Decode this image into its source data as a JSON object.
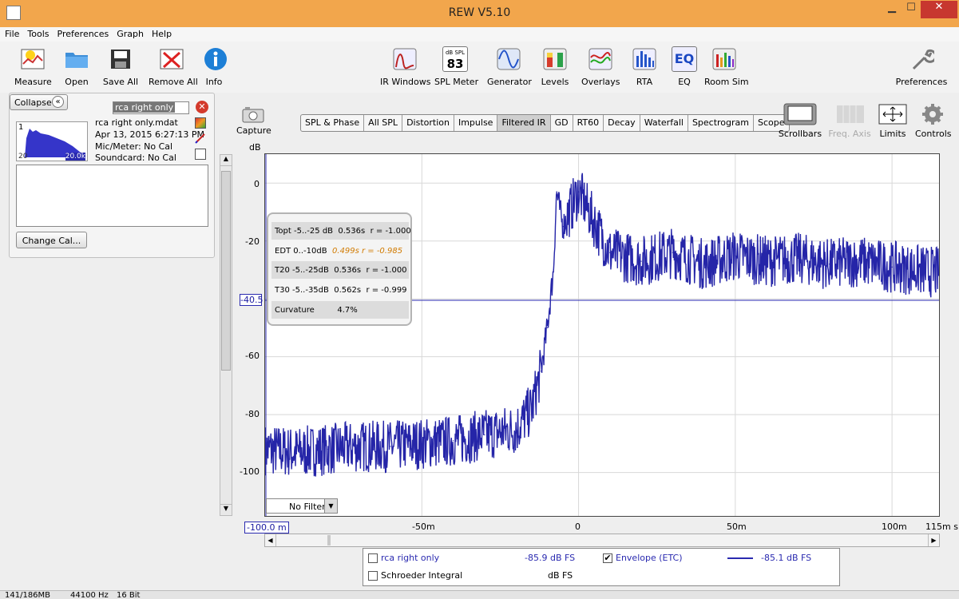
{
  "window": {
    "title": "REW V5.10",
    "minimize": "▁",
    "maximize": "☐",
    "close": "✕"
  },
  "menu": [
    "File",
    "Tools",
    "Preferences",
    "Graph",
    "Help"
  ],
  "toolbar": {
    "measure": "Measure",
    "open": "Open",
    "save_all": "Save All",
    "remove_all": "Remove All",
    "info": "Info",
    "ir_windows": "IR Windows",
    "spl_meter": "SPL Meter",
    "spl_badge_top": "dB SPL",
    "spl_badge_val": "83",
    "generator": "Generator",
    "levels": "Levels",
    "overlays": "Overlays",
    "rta": "RTA",
    "eq": "EQ",
    "eq_badge": "EQ",
    "room_sim": "Room Sim",
    "preferences": "Preferences"
  },
  "measurements_panel": {
    "collapse": "Collapse",
    "collapse_icon": "«",
    "name_field": "rca right only",
    "index": "1",
    "file": "rca right only.mdat",
    "date": "Apr 13, 2015 6:27:13 PM",
    "mic": "Mic/Meter: No Cal",
    "soundcard": "Soundcard: No Cal",
    "thumb_left": "20",
    "thumb_right": "20.0k",
    "change_cal": "Change Cal..."
  },
  "graph_controls": {
    "capture": "Capture",
    "scrollbars": "Scrollbars",
    "freq_axis": "Freq. Axis",
    "limits": "Limits",
    "controls": "Controls"
  },
  "tabs": [
    {
      "label": "SPL & Phase",
      "active": false
    },
    {
      "label": "All SPL",
      "active": false
    },
    {
      "label": "Distortion",
      "active": false
    },
    {
      "label": "Impulse",
      "active": false
    },
    {
      "label": "Filtered IR",
      "active": true
    },
    {
      "label": "GD",
      "active": false
    },
    {
      "label": "RT60",
      "active": false
    },
    {
      "label": "Decay",
      "active": false
    },
    {
      "label": "Waterfall",
      "active": false
    },
    {
      "label": "Spectrogram",
      "active": false
    },
    {
      "label": "Scope",
      "active": false
    }
  ],
  "axis": {
    "y_unit": "dB",
    "y_ticks": [
      "0",
      "-20",
      "-40.5",
      "-60",
      "-80",
      "-100"
    ],
    "x_ticks": [
      "-100.0 m",
      "-50m",
      "0",
      "50m",
      "100m",
      "115m s"
    ]
  },
  "rt_table": {
    "rows": [
      {
        "label": "Topt -5..-25 dB",
        "time": "0.536s",
        "r": "r = -1.000",
        "highlight": false
      },
      {
        "label": "EDT  0..-10dB",
        "time": "0.499s",
        "r": "r = -0.985",
        "highlight": true
      },
      {
        "label": "T20 -5..-25dB",
        "time": "0.536s",
        "r": "r = -1.000",
        "highlight": false
      },
      {
        "label": "T30 -5..-35dB",
        "time": "0.562s",
        "r": "r = -0.999",
        "highlight": false
      },
      {
        "label": "Curvature",
        "time": "4.7%",
        "r": "",
        "highlight": false
      }
    ]
  },
  "filter": {
    "value": "No Filter"
  },
  "legend": {
    "row1_name": "rca right only",
    "row1_value": "-85.9 dB FS",
    "envelope_name": "Envelope (ETC)",
    "envelope_value": "-85.1 dB FS",
    "envelope_checked": "✔",
    "row2_name": "Schroeder Integral",
    "row2_value": "dB FS"
  },
  "statusbar": {
    "memory": "141/186MB",
    "rate": "44100 Hz",
    "bits": "16 Bit"
  },
  "chart_data": {
    "type": "line",
    "xlabel": "",
    "ylabel": "dB",
    "xlim": [
      -100,
      115
    ],
    "ylim": [
      -115,
      10
    ],
    "cursor_y": -40.5,
    "series": [
      {
        "color": "#2525a8",
        "x": [
          -100,
          -90,
          -80,
          -70,
          -60,
          -50,
          -40,
          -30,
          -20,
          -15,
          -12,
          -10,
          -8,
          -7,
          -5,
          -3,
          0,
          10,
          20,
          30,
          40,
          50,
          60,
          70,
          80,
          90,
          100,
          115
        ],
        "y": [
          -92,
          -93,
          -92,
          -91,
          -91,
          -90,
          -89,
          -87,
          -85,
          -78,
          -65,
          -50,
          -30,
          -3,
          -15,
          -10,
          -3,
          -24,
          -27,
          -24,
          -28,
          -25,
          -27,
          -26,
          -28,
          -27,
          -29,
          -31
        ]
      }
    ]
  }
}
